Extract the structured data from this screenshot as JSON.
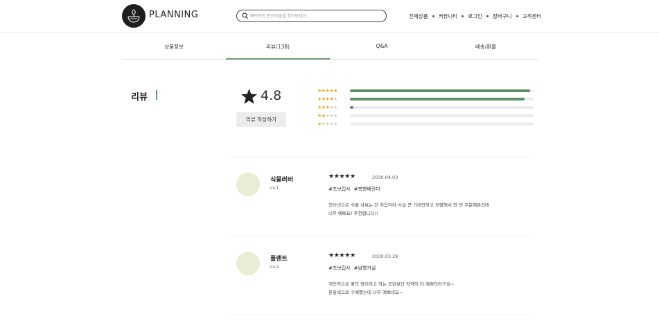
{
  "header": {
    "brand": "PLANNING",
    "search": {
      "placeholder": "매력적인 반려식물을 찾아보세요."
    },
    "nav": [
      "전체상품",
      "커뮤니티",
      "로그인",
      "장바구니",
      "고객센터"
    ]
  },
  "tabs": [
    {
      "label": "상품정보",
      "active": false
    },
    {
      "label": "리뷰(138)",
      "active": true
    },
    {
      "label": "Q&A",
      "active": false
    },
    {
      "label": "배송/환불",
      "active": false
    }
  ],
  "summary": {
    "title": "리뷰",
    "rating": "4.8",
    "write_button": "리뷰 작성하기",
    "distribution": [
      {
        "stars": 5,
        "fraction": 0.98
      },
      {
        "stars": 4,
        "fraction": 0.95
      },
      {
        "stars": 3,
        "fraction": 0.02
      },
      {
        "stars": 2,
        "fraction": 0.0
      },
      {
        "stars": 1,
        "fraction": 0.0
      }
    ]
  },
  "reviews": [
    {
      "name": "식물러버",
      "level": "Lv.1",
      "stars": "★★★★★",
      "date": "2030.04.03",
      "tags": [
        "#초보집사",
        "#북향베란다"
      ],
      "body": [
        "인터넷으로 식물 사보는 건 처음이라 사실 큰 기대안하고 저렴해서 한 번 주문해본건데",
        "너무 예뻐요! 추천합니다!!"
      ]
    },
    {
      "name": "플랜트",
      "level": "Lv.2",
      "stars": "★★★★★",
      "date": "2030.03.29",
      "tags": [
        "#초보집사",
        "#남향거실"
      ],
      "body": [
        "개인적으로 꽃의 왕이라고 하는 모란보단 작약이 더 예쁘더라구요~",
        "분홍색으로 구매했는데 너무 예쁘네요~"
      ]
    }
  ],
  "colors": {
    "accent": "#5e8f63",
    "star_yellow": "#f0a51c",
    "avatar_bg": "#ebecd6"
  }
}
